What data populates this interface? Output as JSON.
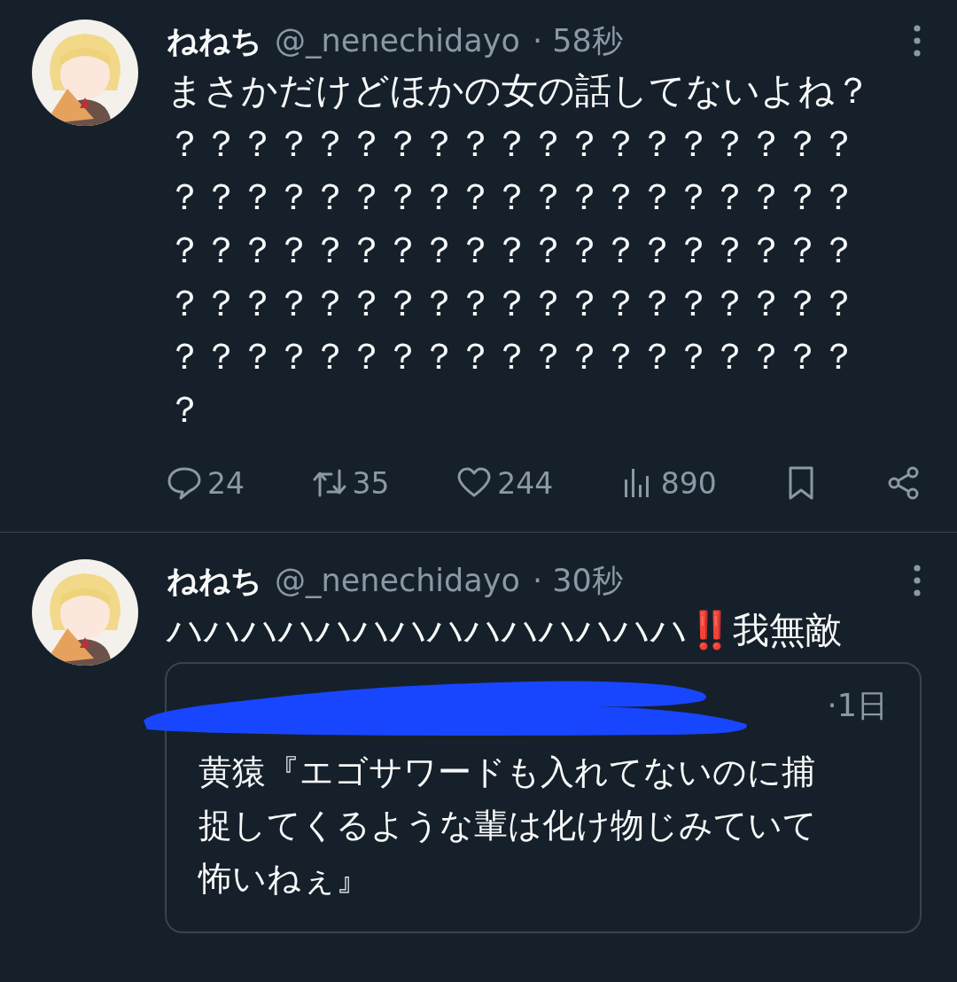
{
  "tweets": [
    {
      "author": {
        "name": "ねねち",
        "handle": "@_nenechidayo",
        "time": "· 58秒"
      },
      "text": "まさかだけどほかの女の話してないよね？？？？？？？？？？？？？？？？？？？？？？？？？？？？？？？？？？？？？？？？？？？？？？？？？？？？？？？？？？？？？？？？？？？？？？？？？？？？？？？？？？？？？？？？？？？？？？？？？",
      "stats": {
        "replies": "24",
        "retweets": "35",
        "likes": "244",
        "views": "890"
      }
    },
    {
      "author": {
        "name": "ねねち",
        "handle": "@_nenechidayo",
        "time": "· 30秒"
      },
      "text": "ハハハハハハハハハハハハハハ‼️我無敵",
      "quote": {
        "time": "·1日",
        "text": "黄猿『エゴサワードも入れてないのに捕捉してくるような輩は化け物じみていて怖いねぇ』"
      }
    }
  ]
}
